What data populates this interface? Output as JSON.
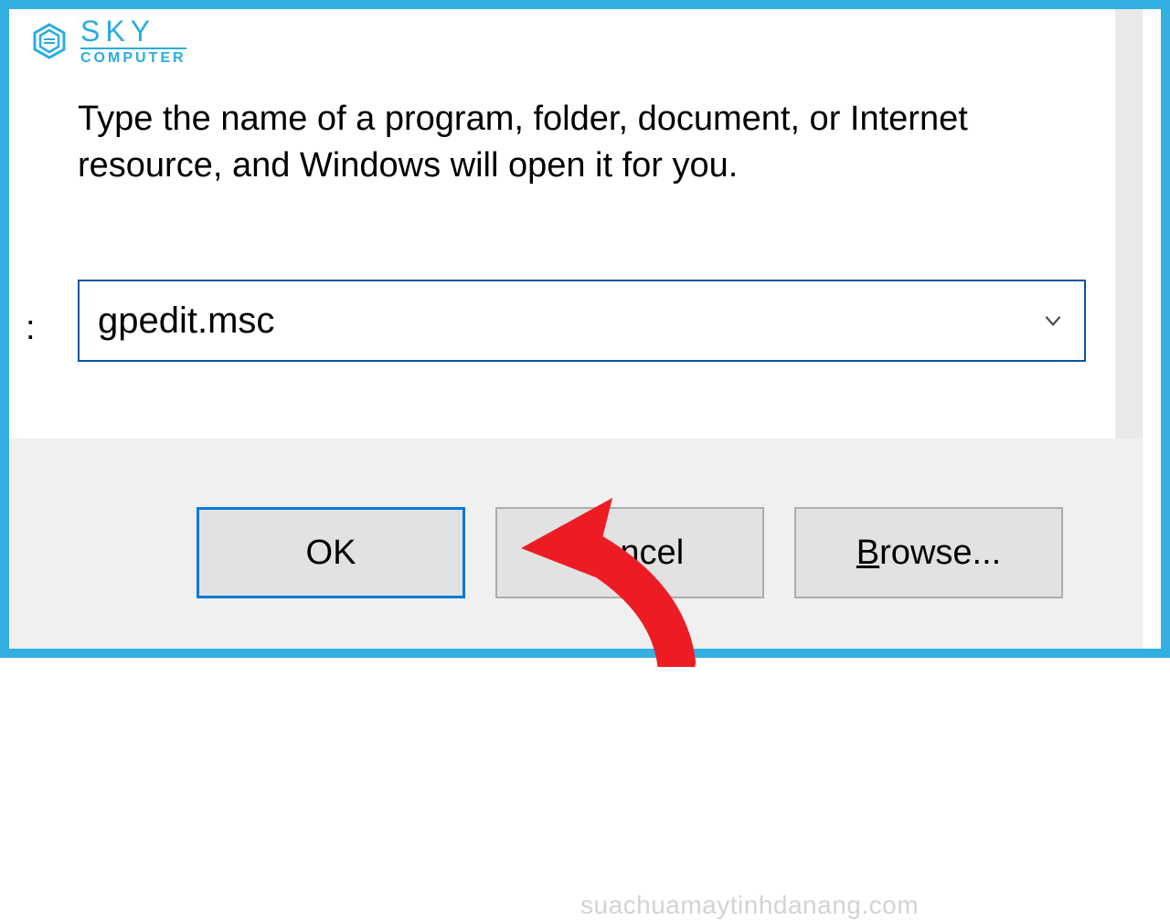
{
  "logo": {
    "top": "SKY",
    "bottom": "COMPUTER"
  },
  "dialog": {
    "description": "Type the name of a program, folder, document, or Internet resource, and Windows will open it for you.",
    "open_colon": ":",
    "input_value": "gpedit.msc"
  },
  "buttons": {
    "ok": "OK",
    "cancel": "Cancel",
    "browse_prefix": "B",
    "browse_rest": "rowse..."
  },
  "watermark": "suachuamaytinhdanang.com",
  "colors": {
    "frame": "#34afe1",
    "accent": "#0a78d6",
    "arrow": "#ed1c24"
  }
}
